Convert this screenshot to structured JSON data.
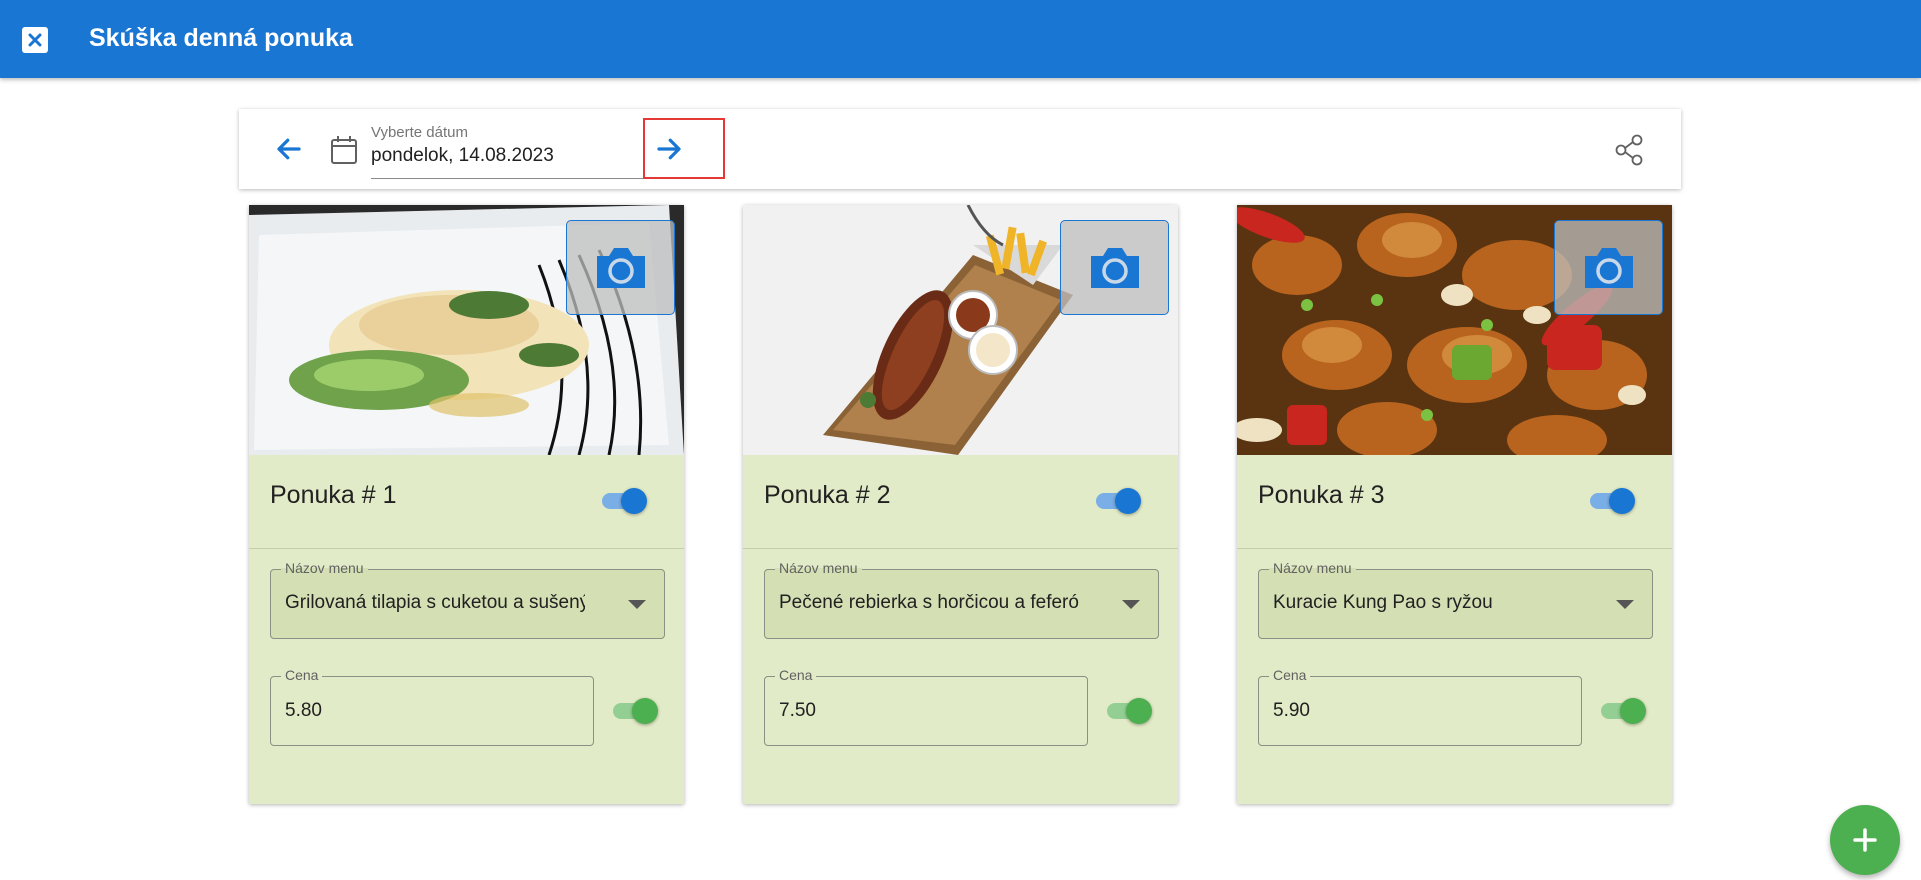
{
  "app": {
    "title": "Skúška denná ponuka"
  },
  "toolbar": {
    "date_label": "Vyberte dátum",
    "date_value": "pondelok, 14.08.2023"
  },
  "cards": [
    {
      "title": "Ponuka # 1",
      "active": true,
      "menu_label": "Názov menu",
      "menu_value": "Grilovaná tilapia s cuketou a sušenými paradajkami",
      "price_label": "Cena",
      "price_value": "5.80",
      "price_active": true,
      "image": "grilled-tilapia-zucchini"
    },
    {
      "title": "Ponuka # 2",
      "active": true,
      "menu_label": "Názov menu",
      "menu_value": "Pečené rebierka s horčicou a feferónkou",
      "price_label": "Cena",
      "price_value": "7.50",
      "price_active": true,
      "image": "roasted-ribs-fries"
    },
    {
      "title": "Ponuka # 3",
      "active": true,
      "menu_label": "Názov menu",
      "menu_value": "Kuracie Kung Pao s ryžou",
      "price_label": "Cena",
      "price_value": "5.90",
      "price_active": true,
      "image": "kung-pao-chicken"
    }
  ],
  "colors": {
    "primary": "#1976d2",
    "card_bg": "#e2ebc7",
    "accent_green": "#4caf50",
    "highlight": "#e53935"
  },
  "icons": [
    "close-icon",
    "arrow-left-icon",
    "calendar-icon",
    "arrow-right-icon",
    "share-icon",
    "camera-icon",
    "plus-icon"
  ]
}
